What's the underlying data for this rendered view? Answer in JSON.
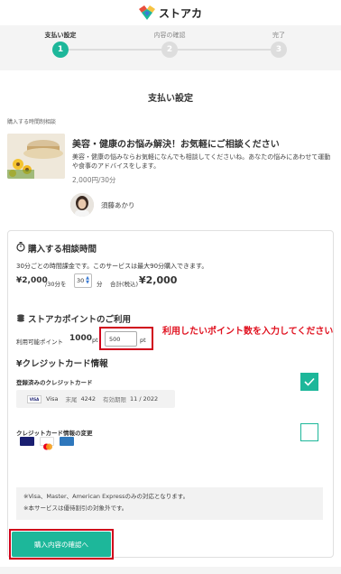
{
  "header": {
    "brand": "ストアカ",
    "colors": {
      "green": "#1db79a",
      "yellow": "#f6c342",
      "red": "#e94e3c",
      "blue": "#3a7bd5"
    }
  },
  "steps": [
    {
      "label": "支払い設定",
      "number": "1",
      "active": true
    },
    {
      "label": "内容の確認",
      "number": "2",
      "active": false
    },
    {
      "label": "完了",
      "number": "3",
      "active": false
    }
  ],
  "page_title": "支払い設定",
  "service": {
    "section_label": "購入する時間制相談",
    "title": "美容・健康のお悩み解決！お気軽にご相談ください",
    "description": "美容・健康の悩みならお気軽になんでも相談してくださいね。あなたの悩みにあわせて運動や食事のアドバイスをします。",
    "price": "2,000円/30分",
    "coach_name": "須藤あかり"
  },
  "purchase_time": {
    "heading": "購入する相談時間",
    "icon": "stopwatch-icon",
    "note": "30分ごとの時間課金です。このサービスは最大90分購入できます。",
    "unit_price": "¥2,000",
    "unit_suffix": "/30分を",
    "minutes_value": "30",
    "minutes_unit": "分",
    "total_label": "合計(税込)",
    "total": "¥2,000"
  },
  "points": {
    "heading": "ストアカポイントのご利用",
    "icon": "coins-icon",
    "available_label": "利用可能ポイント",
    "available": "1000",
    "available_unit": "pt",
    "input_value": "500",
    "input_unit": "pt",
    "annotation": "利用したいポイント数を入力してください"
  },
  "card": {
    "heading": "クレジットカード情報",
    "icon": "yen-icon",
    "registered_label": "登録済みのクレジットカード",
    "registered_checked": true,
    "brand": "Visa",
    "tail_label": "末尾",
    "tail": "4242",
    "expiry_label": "有効期限",
    "expiry": "11 / 2022",
    "change_label": "クレジットカード情報の変更",
    "change_checked": false,
    "brands": [
      "visa-icon",
      "mastercard-icon",
      "amex-icon"
    ]
  },
  "notice": {
    "line1": "※Visa、Master、American Expressのみの対応となります。",
    "line2": "※本サービスは優待割引の対象外です。"
  },
  "cta_label": "購入内容の確認へ"
}
